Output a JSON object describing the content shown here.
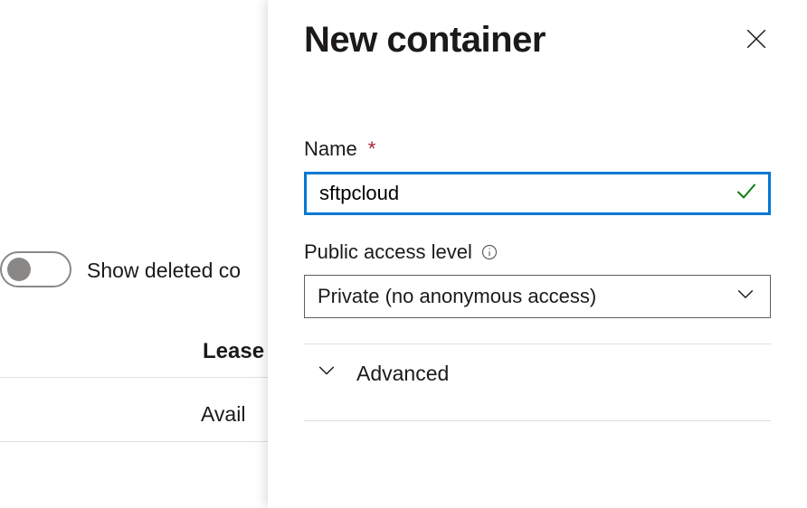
{
  "panel": {
    "title": "New container",
    "name_field": {
      "label": "Name",
      "required_marker": "*",
      "value": "sftpcloud"
    },
    "access_field": {
      "label": "Public access level",
      "value": "Private (no anonymous access)"
    },
    "advanced_label": "Advanced"
  },
  "background": {
    "show_deleted_label": "Show deleted co",
    "table_header": "Lease",
    "table_cell": "Avail"
  }
}
